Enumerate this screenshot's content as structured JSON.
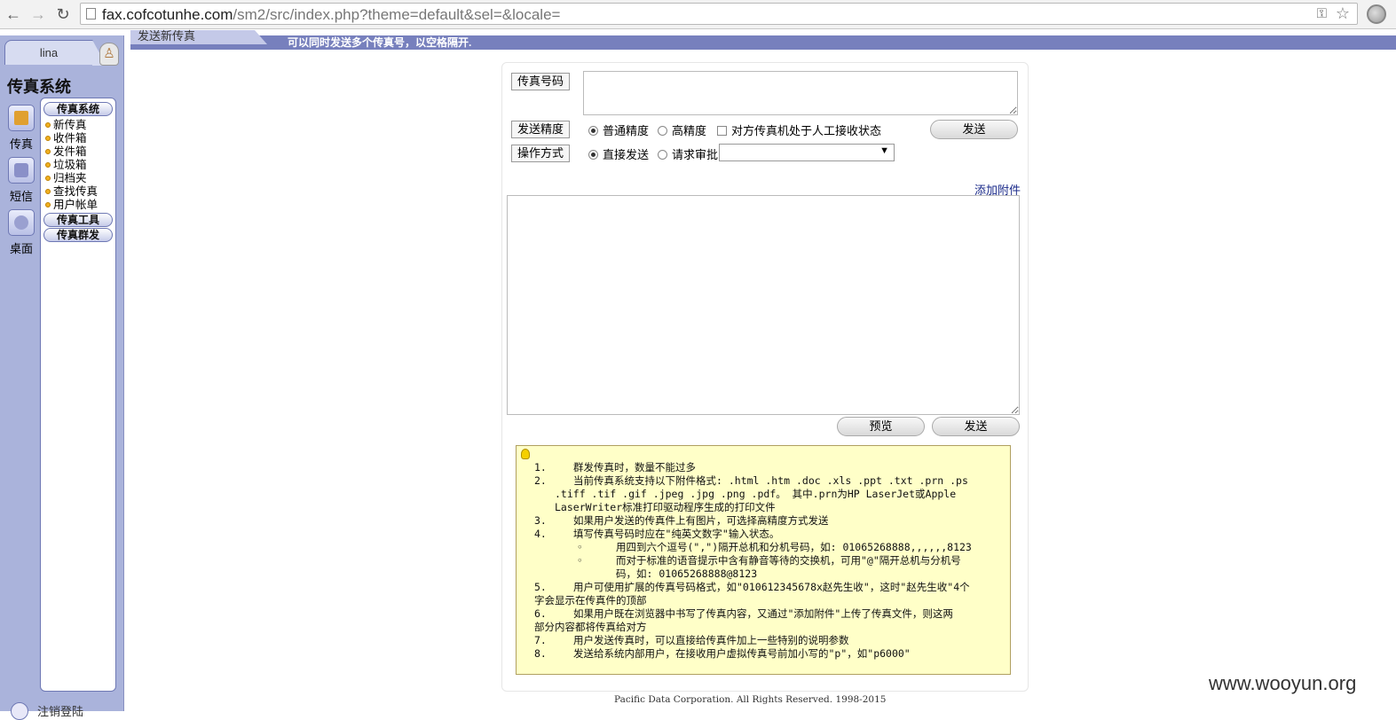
{
  "browser": {
    "url_domain": "fax.cofcotunhe.com",
    "url_path": "/sm2/src/index.php?theme=default&sel=&locale="
  },
  "sidebar": {
    "user_tab": "lina",
    "system_title": "传真系统",
    "icons": [
      {
        "label": "传真",
        "icon": "fax-icon"
      },
      {
        "label": "短信",
        "icon": "phone-icon"
      },
      {
        "label": "桌面",
        "icon": "tools-icon"
      }
    ],
    "sections": {
      "fax_system": "传真系统",
      "fax_tools": "传真工具",
      "fax_broadcast": "传真群发"
    },
    "items": [
      "新传真",
      "收件箱",
      "发件箱",
      "垃圾箱",
      "归档夹",
      "查找传真",
      "用户帐单"
    ],
    "bottom_label": "注销登陆"
  },
  "banner": {
    "tab": "发送新传真",
    "hint": "可以同时发送多个传真号，以空格隔开."
  },
  "form": {
    "fax_number_label": "传真号码",
    "precision_label": "发送精度",
    "precision_normal": "普通精度",
    "precision_high": "高精度",
    "manual_receive": "对方传真机处于人工接收状态",
    "send_label": "发送",
    "operation_label": "操作方式",
    "direct_send": "直接发送",
    "request_approval": "请求审批",
    "add_attachment": "添加附件",
    "preview_label": "预览",
    "send_bottom_label": "发送"
  },
  "notes": [
    {
      "num": "1.",
      "text": "群发传真时，数量不能过多"
    },
    {
      "num": "2.",
      "text": "当前传真系统支持以下附件格式: .html .htm .doc .xls .ppt .txt .prn .ps",
      "cont": [
        ".tiff .tif .gif .jpeg .jpg .png .pdf。 其中.prn为HP LaserJet或Apple",
        "LaserWriter标准打印驱动程序生成的打印文件"
      ]
    },
    {
      "num": "3.",
      "text": "如果用户发送的传真件上有图片，可选择高精度方式发送"
    },
    {
      "num": "4.",
      "text": "填写传真号码时应在\"纯英文数字\"输入状态。"
    },
    {
      "num": "◦",
      "text": "用四到六个逗号(\",\")隔开总机和分机号码，如: 01065268888,,,,,,8123",
      "sub": true
    },
    {
      "num": "◦",
      "text": "而对于标准的语音提示中含有静音等待的交换机，可用\"@\"隔开总机与分机号",
      "sub": true,
      "cont": [
        "码，如: 01065268888@8123"
      ]
    },
    {
      "num": "5.",
      "text": "用户可使用扩展的传真号码格式，如\"010612345678x赵先生收\"，这时\"赵先生收\"4个",
      "cont": [
        "字会显示在传真件的顶部"
      ]
    },
    {
      "num": "6.",
      "text": "如果用户既在浏览器中书写了传真内容，又通过\"添加附件\"上传了传真文件，则这两",
      "cont": [
        "部分内容都将传真给对方"
      ]
    },
    {
      "num": "7.",
      "text": "用户发送传真时，可以直接给传真件加上一些特别的说明参数"
    },
    {
      "num": "8.",
      "text": "发送给系统内部用户，在接收用户虚拟传真号前加小写的\"p\"，如\"p6000\""
    }
  ],
  "footer": "Pacific Data Corporation. All Rights Reserved. 1998-2015",
  "watermark": "www.wooyun.org"
}
